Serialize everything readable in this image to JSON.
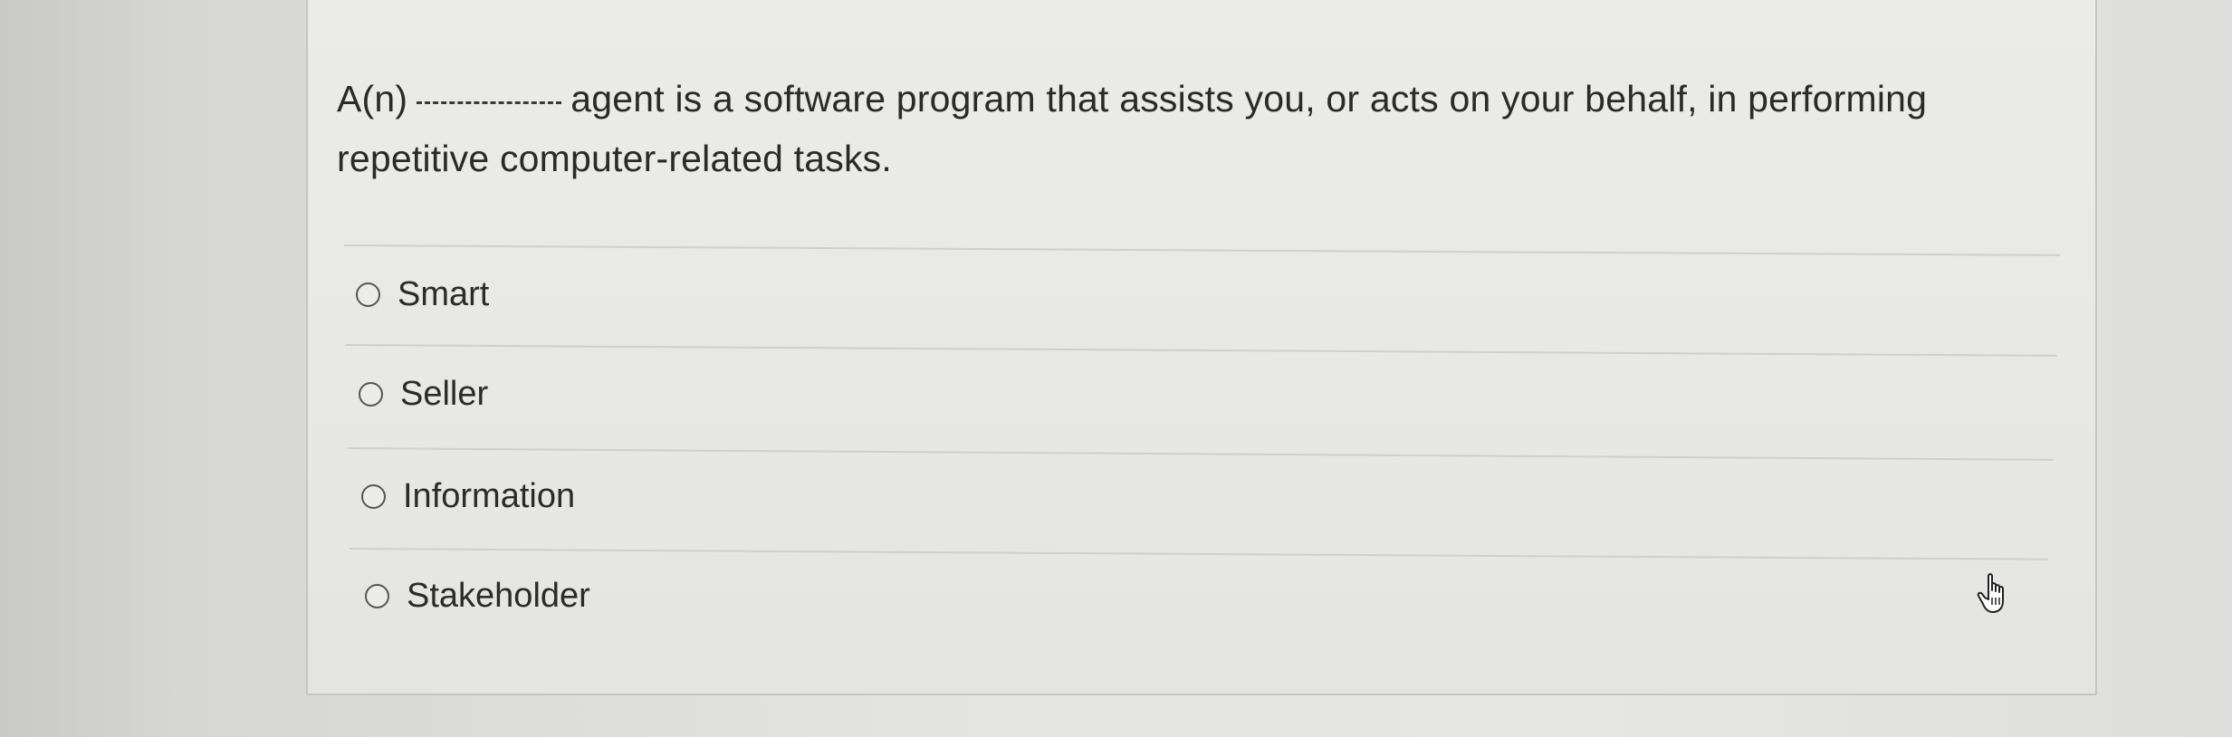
{
  "question": {
    "prefix": "A(n)",
    "suffix": "agent is a software program that assists you, or acts on your behalf, in performing repetitive computer-related tasks."
  },
  "options": [
    {
      "label": "Smart",
      "selected": false
    },
    {
      "label": "Seller",
      "selected": false
    },
    {
      "label": "Information",
      "selected": false
    },
    {
      "label": "Stakeholder",
      "selected": false
    }
  ],
  "icons": {
    "radio": "radio-button-unselected",
    "cursor": "hand-pointer-icon"
  }
}
